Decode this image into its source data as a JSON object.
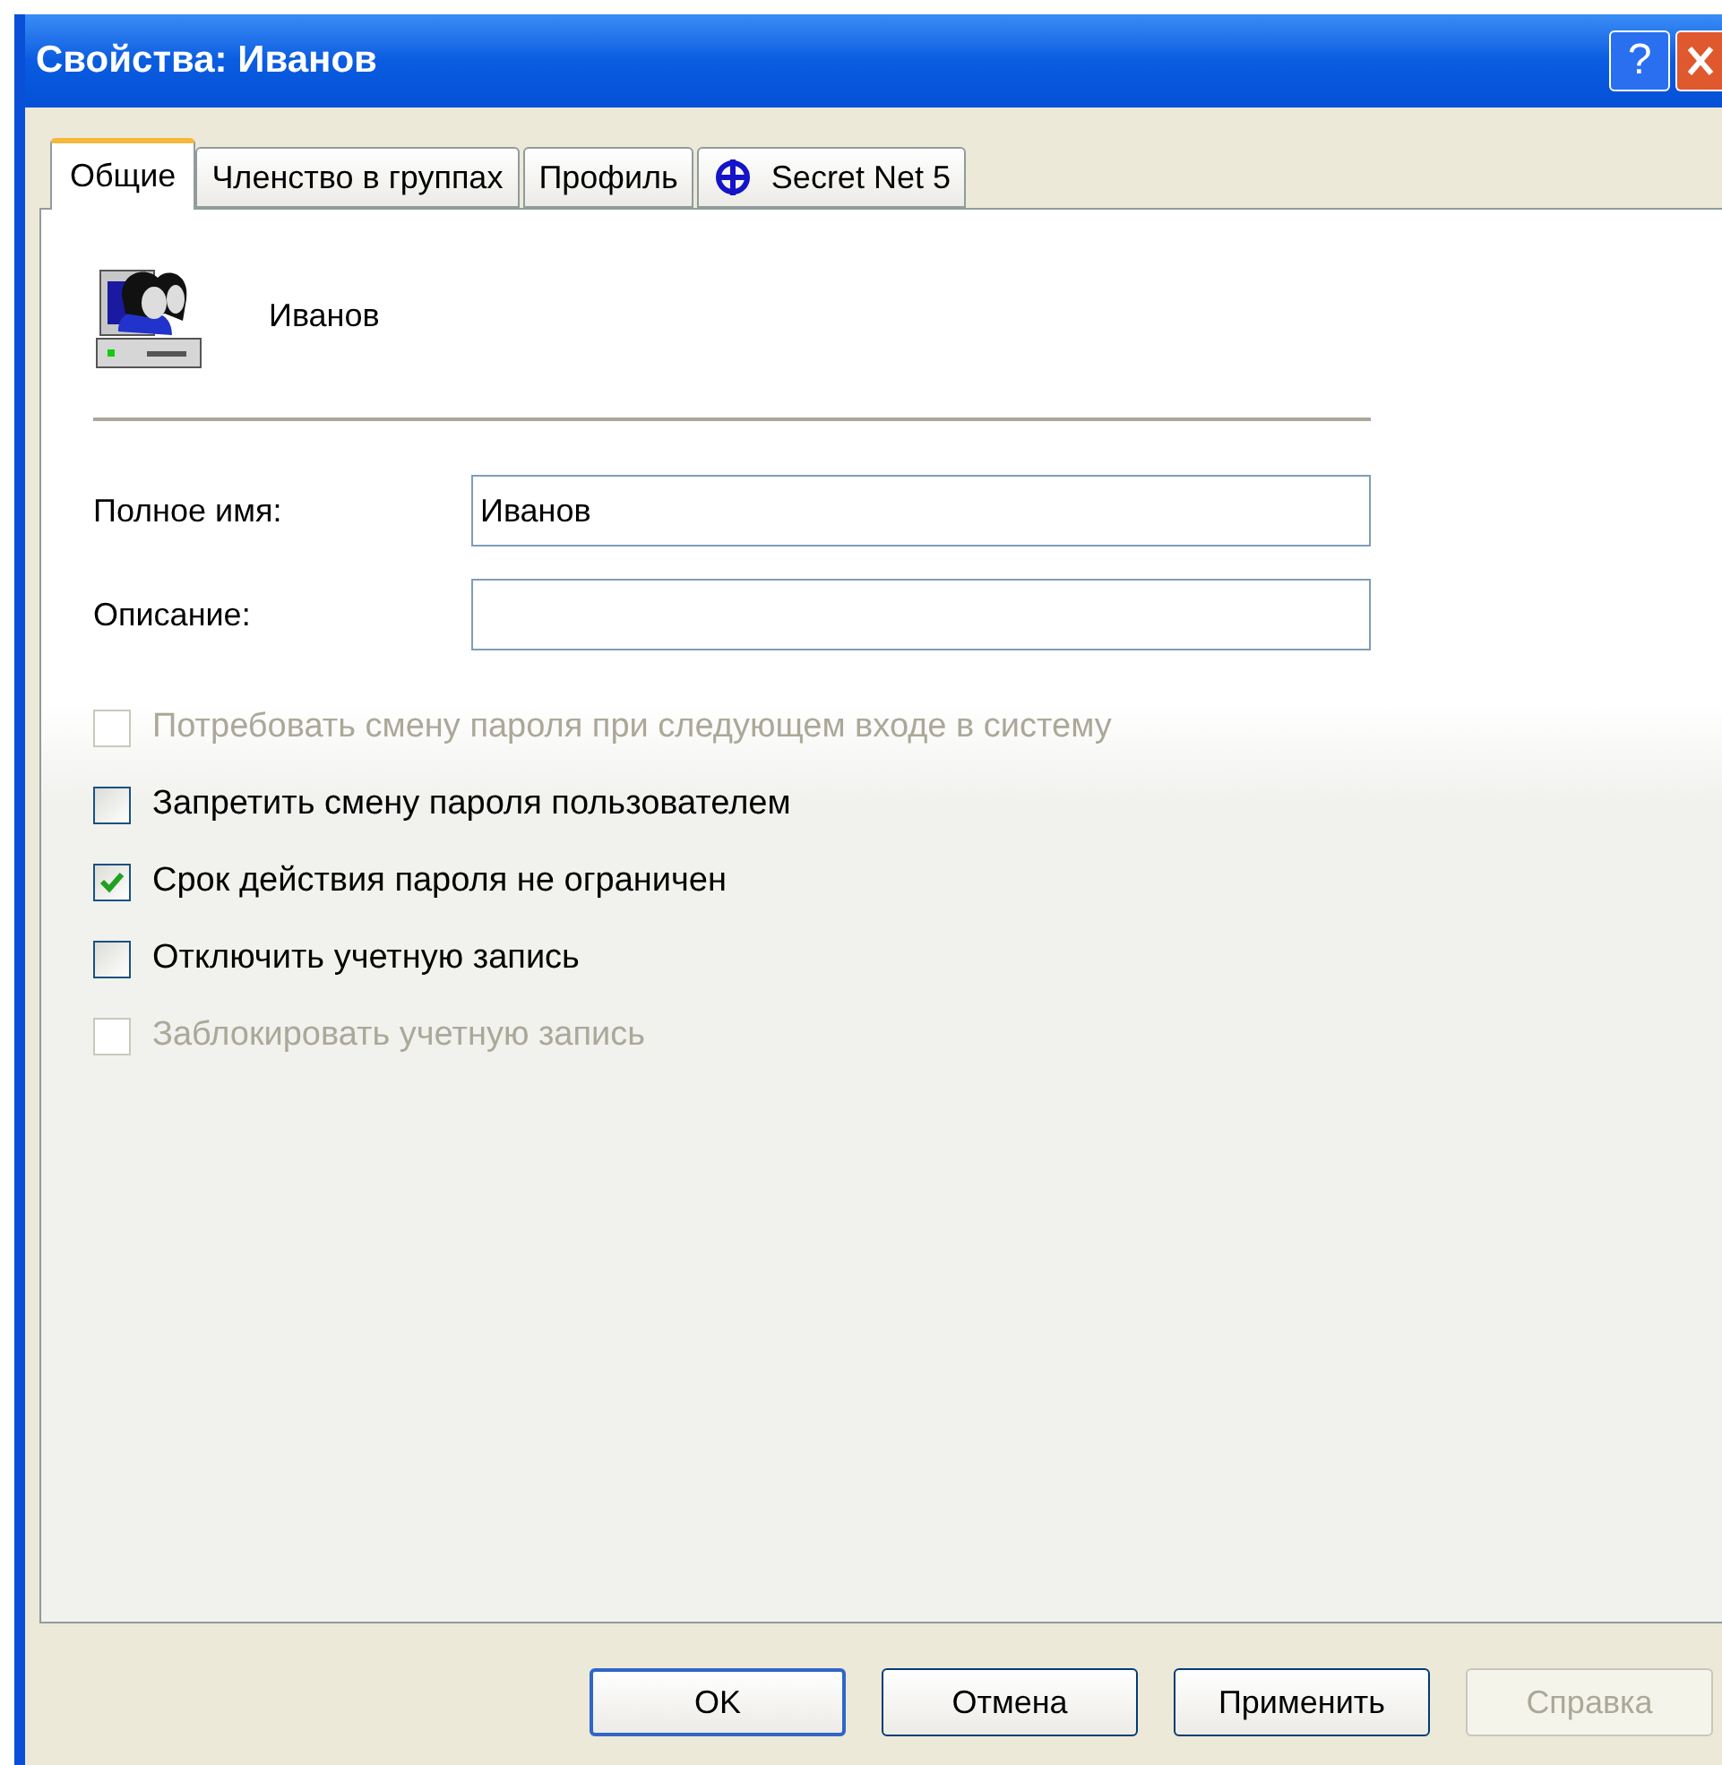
{
  "window": {
    "title": "Свойства: Иванов",
    "help_button": "?"
  },
  "tabs": [
    {
      "label": "Общие",
      "selected": true,
      "icon": false
    },
    {
      "label": "Членство в группах",
      "selected": false,
      "icon": false
    },
    {
      "label": "Профиль",
      "selected": false,
      "icon": false
    },
    {
      "label": "Secret Net 5",
      "selected": false,
      "icon": true
    }
  ],
  "user": {
    "name": "Иванов"
  },
  "fields": [
    {
      "label": "Полное имя:",
      "value": "Иванов"
    },
    {
      "label": "Описание:"
    }
  ],
  "checkboxes": [
    {
      "label": "Потребовать смену пароля при следующем входе в систему",
      "checked": false,
      "disabled": true
    },
    {
      "label": "Запретить смену пароля пользователем",
      "checked": false,
      "disabled": false
    },
    {
      "label": "Срок действия пароля не ограничен",
      "checked": true,
      "disabled": false
    },
    {
      "label": "Отключить учетную запись",
      "checked": false,
      "disabled": false
    },
    {
      "label": "Заблокировать учетную запись",
      "checked": false,
      "disabled": true
    }
  ],
  "buttons": [
    {
      "label": "OK",
      "default": true,
      "disabled": false
    },
    {
      "label": "Отмена",
      "default": false,
      "disabled": false
    },
    {
      "label": "Применить",
      "default": false,
      "disabled": false
    },
    {
      "label": "Справка",
      "default": false,
      "disabled": true
    }
  ]
}
